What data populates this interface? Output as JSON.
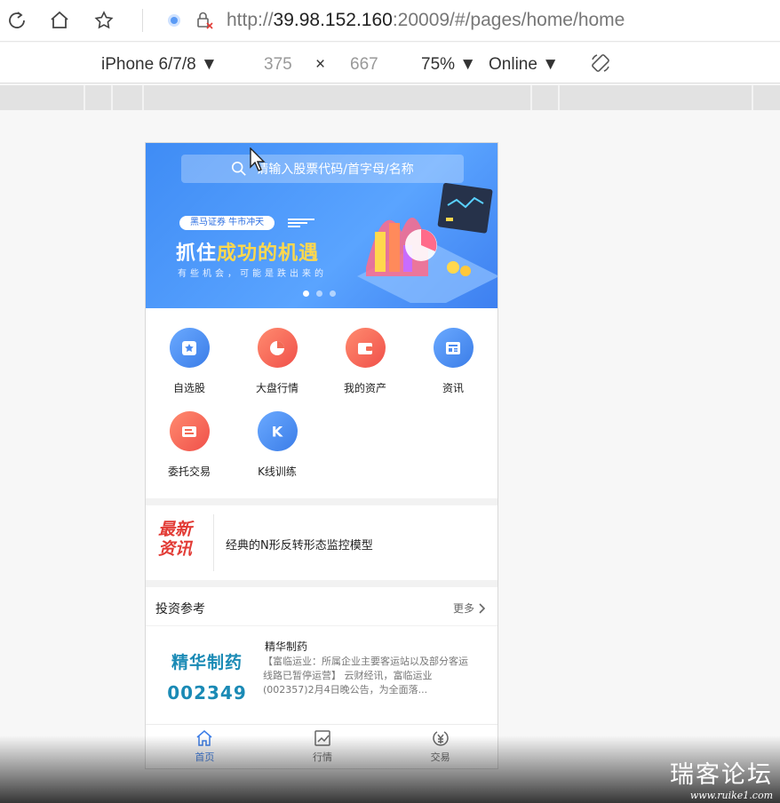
{
  "browser": {
    "url_prefix": "http://",
    "url_host": "39.98.152.160",
    "url_rest": ":20009/#/pages/home/home"
  },
  "device_toolbar": {
    "device": "iPhone 6/7/8 ▼",
    "width": "375",
    "times": "×",
    "height": "667",
    "zoom": "75% ▼",
    "network": "Online ▼"
  },
  "app": {
    "search_placeholder": "请输入股票代码/首字母/名称",
    "banner": {
      "tag": "黑马证券  牛市冲天",
      "slogan_part1": "抓住",
      "slogan_part2": "成功的机遇",
      "subtitle": "有些机会，可能是跌出来的",
      "dot_count": 3,
      "active_dot": 0
    },
    "grid_items": [
      {
        "label": "自选股",
        "icon": "star-icon",
        "color": "blue"
      },
      {
        "label": "大盘行情",
        "icon": "pie-chart-icon",
        "color": "red"
      },
      {
        "label": "我的资产",
        "icon": "wallet-icon",
        "color": "red"
      },
      {
        "label": "资讯",
        "icon": "news-icon",
        "color": "blue"
      },
      {
        "label": "委托交易",
        "icon": "ticket-icon",
        "color": "red"
      },
      {
        "label": "K线训练",
        "icon": "k-letter-icon",
        "color": "blue"
      }
    ],
    "news": {
      "badge_line1": "最新",
      "badge_line2": "资讯",
      "headline": "经典的N形反转形态监控模型"
    },
    "reference": {
      "title": "投资参考",
      "more": "更多",
      "item": {
        "logo_line1": "精华制药",
        "logo_line2": "002349",
        "name": "精华制药",
        "desc": "【富临运业：所属企业主要客运站以及部分客运线路已暂停运营】 云财经讯，富临运业(002357)2月4日晚公告，为全面落..."
      }
    },
    "tabs": [
      {
        "label": "首页",
        "icon": "home-icon",
        "active": true
      },
      {
        "label": "行情",
        "icon": "chart-icon",
        "active": false
      },
      {
        "label": "交易",
        "icon": "yen-icon",
        "active": false
      }
    ]
  },
  "watermark": {
    "line1": "瑞客论坛",
    "line2": "www.ruike1.com"
  },
  "colors": {
    "accent_blue": "#3b7de8",
    "accent_red": "#f0504a",
    "news_red": "#e23b35",
    "logo_teal": "#1a8ab5"
  }
}
